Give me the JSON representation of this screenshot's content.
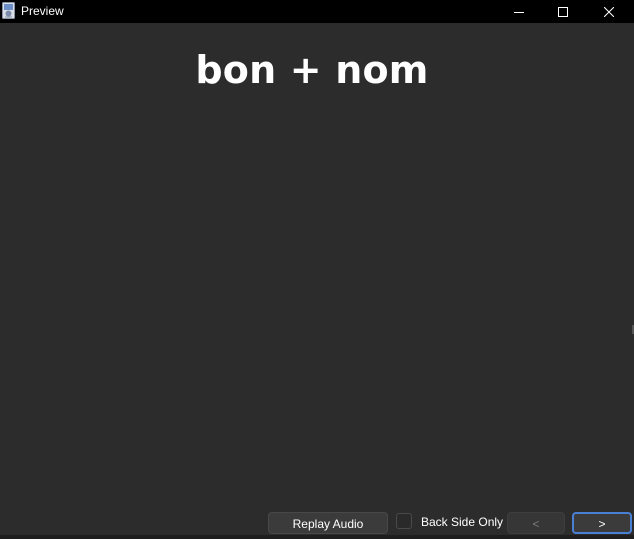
{
  "window": {
    "title": "Preview",
    "app_icon": "preview-app-icon",
    "controls": {
      "minimize_icon": "minimize-icon",
      "maximize_icon": "maximize-icon",
      "close_icon": "close-icon"
    }
  },
  "card": {
    "front_text": "bon + nom"
  },
  "bottom_bar": {
    "replay_label": "Replay Audio",
    "back_side_only": {
      "label": "Back Side Only",
      "checked": false
    },
    "prev_label": "<",
    "next_label": ">"
  },
  "colors": {
    "background": "#2c2c2c",
    "titlebar": "#000000",
    "text": "#ffffff",
    "focus_outline": "#4a7fd6"
  }
}
